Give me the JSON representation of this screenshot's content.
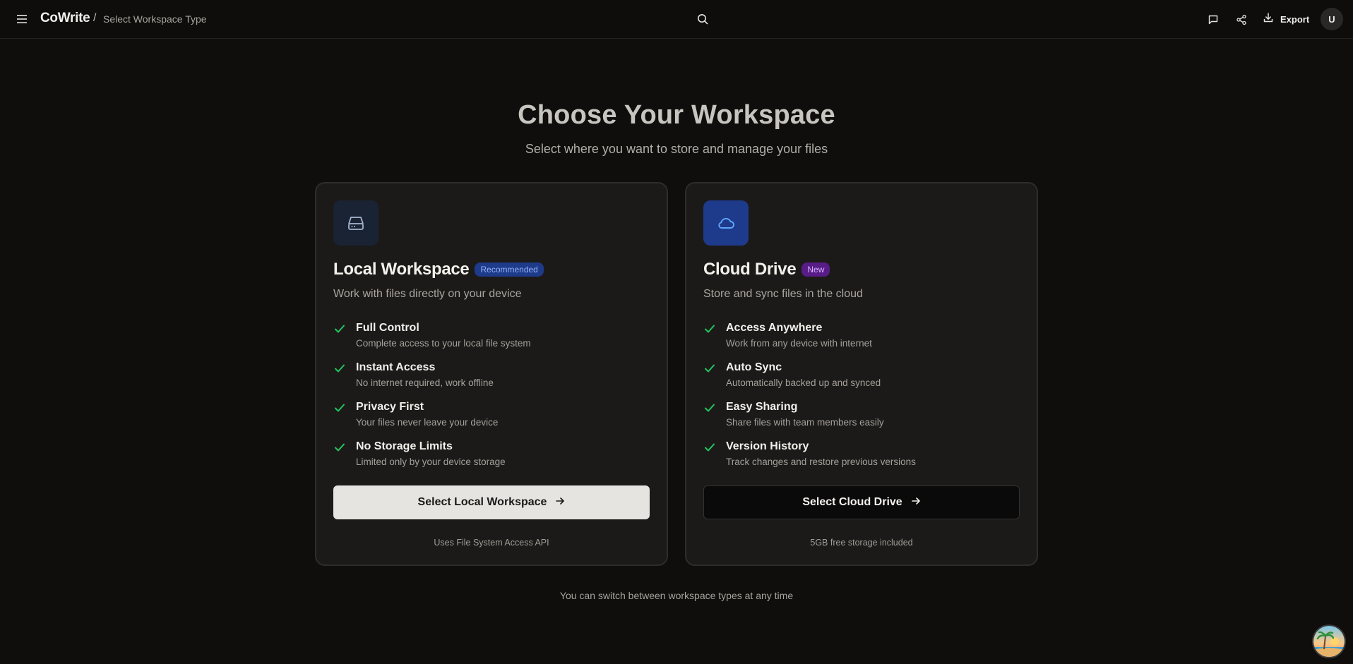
{
  "topbar": {
    "menu_icon": "hamburger-icon",
    "brand": "CoWrite",
    "separator": "/",
    "current_page": "Select Workspace Type",
    "search_icon": "search-icon",
    "comments_icon": "message-square-icon",
    "share_icon": "share-icon",
    "export_label": "Export",
    "export_icon": "download-icon",
    "avatar_initial": "U"
  },
  "hero": {
    "title": "Choose Your Workspace",
    "subtitle": "Select where you want to store and manage your files"
  },
  "cards": [
    {
      "id": "local",
      "icon": "hard-drive-icon",
      "title": "Local Workspace",
      "badge": "Recommended",
      "description": "Work with files directly on your device",
      "features": [
        {
          "title": "Full Control",
          "subtitle": "Complete access to your local file system"
        },
        {
          "title": "Instant Access",
          "subtitle": "No internet required, work offline"
        },
        {
          "title": "Privacy First",
          "subtitle": "Your files never leave your device"
        },
        {
          "title": "No Storage Limits",
          "subtitle": "Limited only by your device storage"
        }
      ],
      "button_label": "Select Local Workspace",
      "footer": "Uses File System Access API"
    },
    {
      "id": "cloud",
      "icon": "cloud-icon",
      "title": "Cloud Drive",
      "badge": "New",
      "description": "Store and sync files in the cloud",
      "features": [
        {
          "title": "Access Anywhere",
          "subtitle": "Work from any device with internet"
        },
        {
          "title": "Auto Sync",
          "subtitle": "Automatically backed up and synced"
        },
        {
          "title": "Easy Sharing",
          "subtitle": "Share files with team members easily"
        },
        {
          "title": "Version History",
          "subtitle": "Track changes and restore previous versions"
        }
      ],
      "button_label": "Select Cloud Drive",
      "footer": "5GB free storage included"
    }
  ],
  "footnote": "You can switch between workspace types at any time",
  "colors": {
    "background": "#0f0e0d",
    "card": "#1c1a19",
    "check": "#22c55e",
    "badge_recommended": "#1e3a8a",
    "badge_new": "#581c87"
  }
}
